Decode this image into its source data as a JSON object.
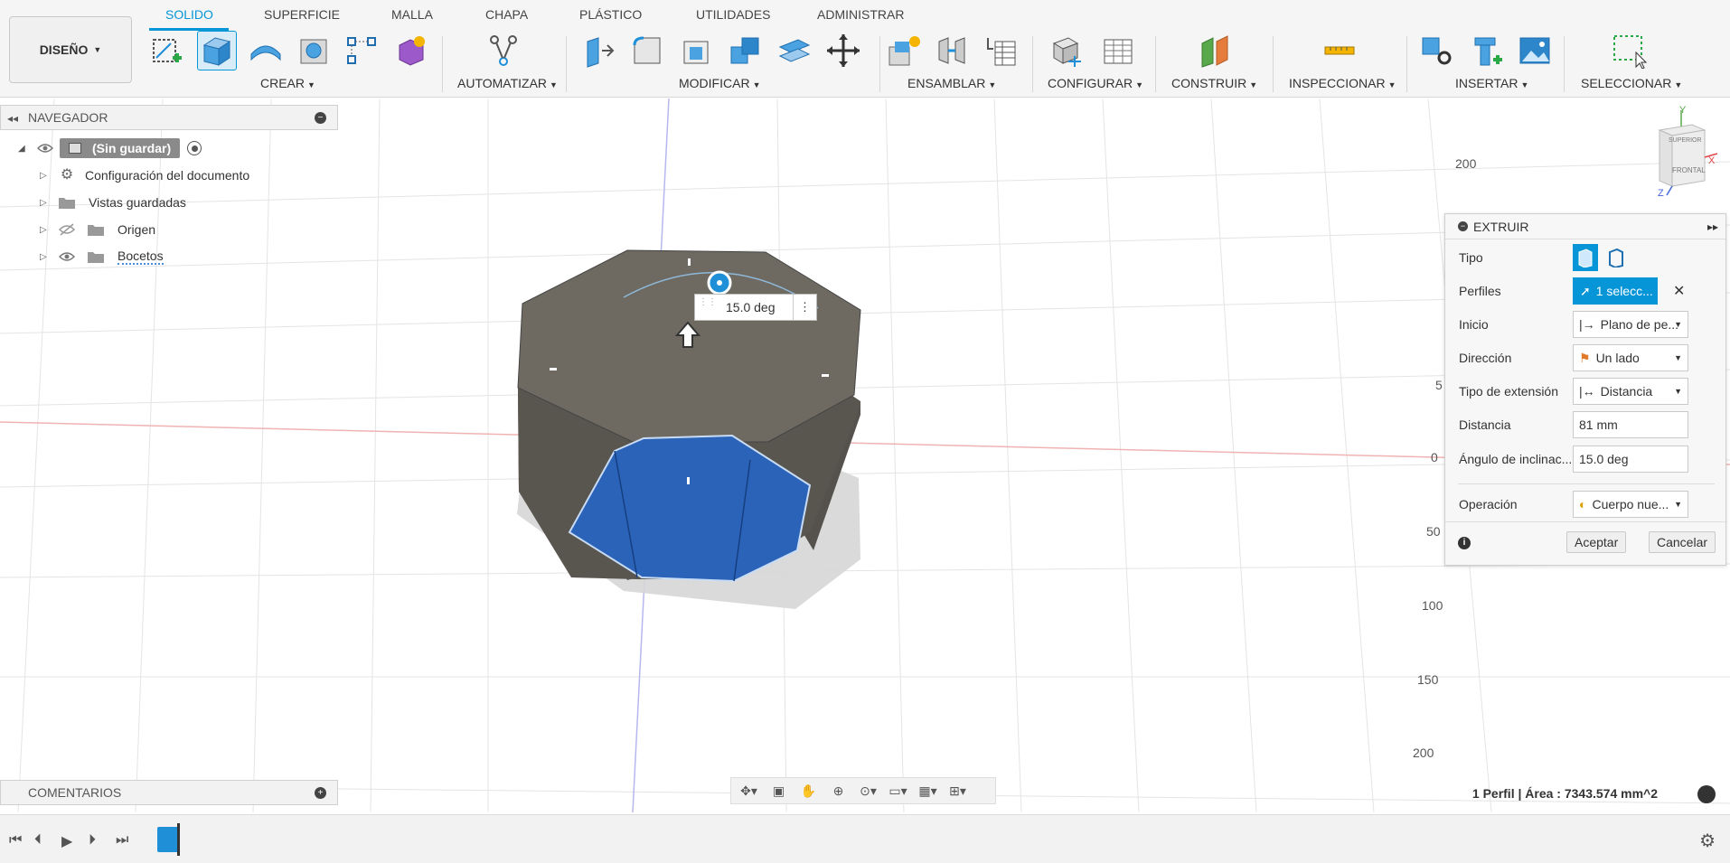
{
  "workspace": {
    "label": "DISEÑO"
  },
  "tabs": [
    "SOLIDO",
    "SUPERFICIE",
    "MALLA",
    "CHAPA",
    "PLÁSTICO",
    "UTILIDADES",
    "ADMINISTRAR"
  ],
  "active_tab": "SOLIDO",
  "groups": {
    "crear": "CREAR",
    "automatizar": "AUTOMATIZAR",
    "modificar": "MODIFICAR",
    "ensamblar": "ENSAMBLAR",
    "configurar": "CONFIGURAR",
    "construir": "CONSTRUIR",
    "inspeccionar": "INSPECCIONAR",
    "insertar": "INSERTAR",
    "seleccionar": "SELECCIONAR"
  },
  "browser": {
    "title": "NAVEGADOR",
    "root": "(Sin guardar)",
    "items": [
      "Configuración del documento",
      "Vistas guardadas",
      "Origen",
      "Bocetos"
    ]
  },
  "comments": {
    "title": "COMENTARIOS"
  },
  "viewcube": {
    "top": "SUPERIOR",
    "front": "FRONTAL",
    "axes": [
      "Y",
      "X",
      "Z"
    ]
  },
  "ruler": {
    "right": [
      "200",
      "5",
      "0",
      "50",
      "100",
      "150",
      "200"
    ]
  },
  "inline_input": {
    "value": "15.0 deg"
  },
  "extrude": {
    "title": "EXTRUIR",
    "rows": {
      "tipo": "Tipo",
      "perfiles": "Perfiles",
      "perfiles_value": "1 selecc...",
      "inicio": "Inicio",
      "inicio_value": "Plano de pe...",
      "direccion": "Dirección",
      "direccion_value": "Un lado",
      "tipo_extension": "Tipo de extensión",
      "tipo_extension_value": "Distancia",
      "distancia": "Distancia",
      "distancia_value": "81 mm",
      "angulo": "Ángulo de inclinac...",
      "angulo_value": "15.0 deg",
      "operacion": "Operación",
      "operacion_value": "Cuerpo nue..."
    },
    "ok": "Aceptar",
    "cancel": "Cancelar"
  },
  "status": "1 Perfil | Área : 7343.574 mm^2",
  "colors": {
    "accent": "#0696d7",
    "profile": "#2a63b8",
    "body": "#6e6a62"
  }
}
